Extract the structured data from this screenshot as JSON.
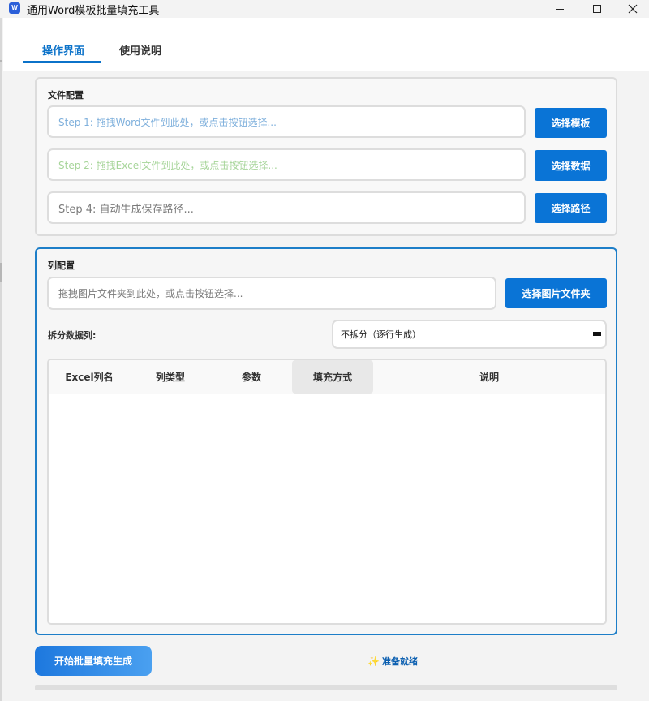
{
  "window": {
    "title": "通用Word模板批量填充工具",
    "icon_letter": "W"
  },
  "tabs": [
    {
      "label": "操作界面",
      "active": true
    },
    {
      "label": "使用说明",
      "active": false
    }
  ],
  "file_config": {
    "title": "文件配置",
    "template": {
      "placeholder": "Step 1: 拖拽Word文件到此处，或点击按钮选择...",
      "button": "选择模板"
    },
    "data": {
      "placeholder": "Step 2: 拖拽Excel文件到此处，或点击按钮选择...",
      "button": "选择数据"
    },
    "output": {
      "placeholder": "Step 4: 自动生成保存路径...",
      "button": "选择路径"
    }
  },
  "column_config": {
    "title": "列配置",
    "images": {
      "placeholder": "拖拽图片文件夹到此处，或点击按钮选择...",
      "button": "选择图片文件夹"
    },
    "split_label": "拆分数据列:",
    "split_value": "不拆分（逐行生成）",
    "table_headers": [
      "Excel列名",
      "列类型",
      "参数",
      "填充方式",
      "说明"
    ],
    "rows": []
  },
  "actions": {
    "start_button": "开始批量填充生成",
    "status_icon": "sparkle-icon",
    "status_text": "准备就绪",
    "progress": 0
  },
  "colors": {
    "accent": "#0a74d6",
    "tab_active": "#0b72c9",
    "status_text": "#0b5fb0",
    "sparkle": "#f2b31e"
  }
}
